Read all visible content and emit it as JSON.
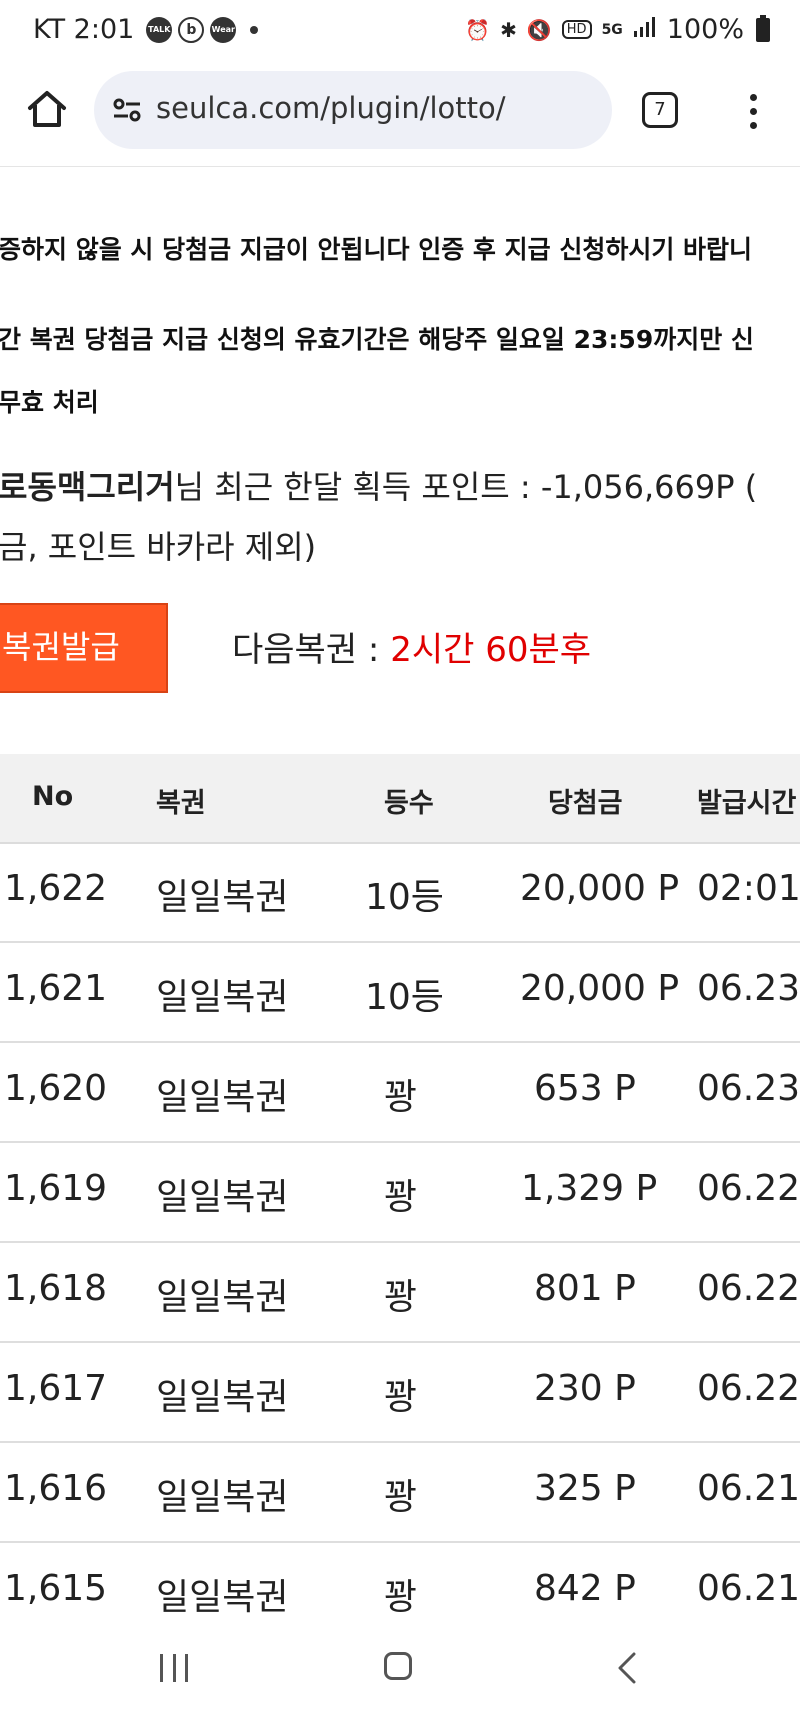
{
  "status_bar": {
    "time": "KT 2:01",
    "notif_icons": [
      "TALK",
      "b",
      "Wear"
    ],
    "right_icons": [
      "alarm-icon",
      "bluetooth-icon",
      "vibrate-icon",
      "hd-icon",
      "5g-icon",
      "signal-icon"
    ],
    "battery": "100%"
  },
  "browser": {
    "url": "seulca.com/plugin/lotto/",
    "tab_count": "7"
  },
  "notices": [
    "증하지 않을 시 당첨금 지급이 안됩니다 인증 후 지급 신청하시기 바랍니",
    "간 복권 당첨금 지급 신청의 유효기간은 해당주 일요일 23:59까지만 신",
    "무효 처리"
  ],
  "points": {
    "user": "로동맥그리거",
    "text": "님 최근 한달 획득 포인트 : -1,056,669P (",
    "text2": "금, 포인트 바카라 제외)"
  },
  "issue_button": "복권발급",
  "next_lotto": {
    "label": "다음복권 : ",
    "value": "2시간 60분후"
  },
  "table": {
    "headers": [
      "No",
      "복권",
      "등수",
      "당첨금",
      "발급시간"
    ],
    "rows": [
      [
        "1,622",
        "일일복권",
        "10등",
        "20,000 P",
        "02:01"
      ],
      [
        "1,621",
        "일일복권",
        "10등",
        "20,000 P",
        "06.23"
      ],
      [
        "1,620",
        "일일복권",
        "꽝",
        "653 P",
        "06.23"
      ],
      [
        "1,619",
        "일일복권",
        "꽝",
        "1,329 P",
        "06.22"
      ],
      [
        "1,618",
        "일일복권",
        "꽝",
        "801 P",
        "06.22"
      ],
      [
        "1,617",
        "일일복권",
        "꽝",
        "230 P",
        "06.22"
      ],
      [
        "1,616",
        "일일복권",
        "꽝",
        "325 P",
        "06.21"
      ],
      [
        "1,615",
        "일일복권",
        "꽝",
        "842 P",
        "06.21"
      ]
    ]
  },
  "colors": {
    "issue_button": "#ff5722",
    "next_value": "#e00000"
  }
}
